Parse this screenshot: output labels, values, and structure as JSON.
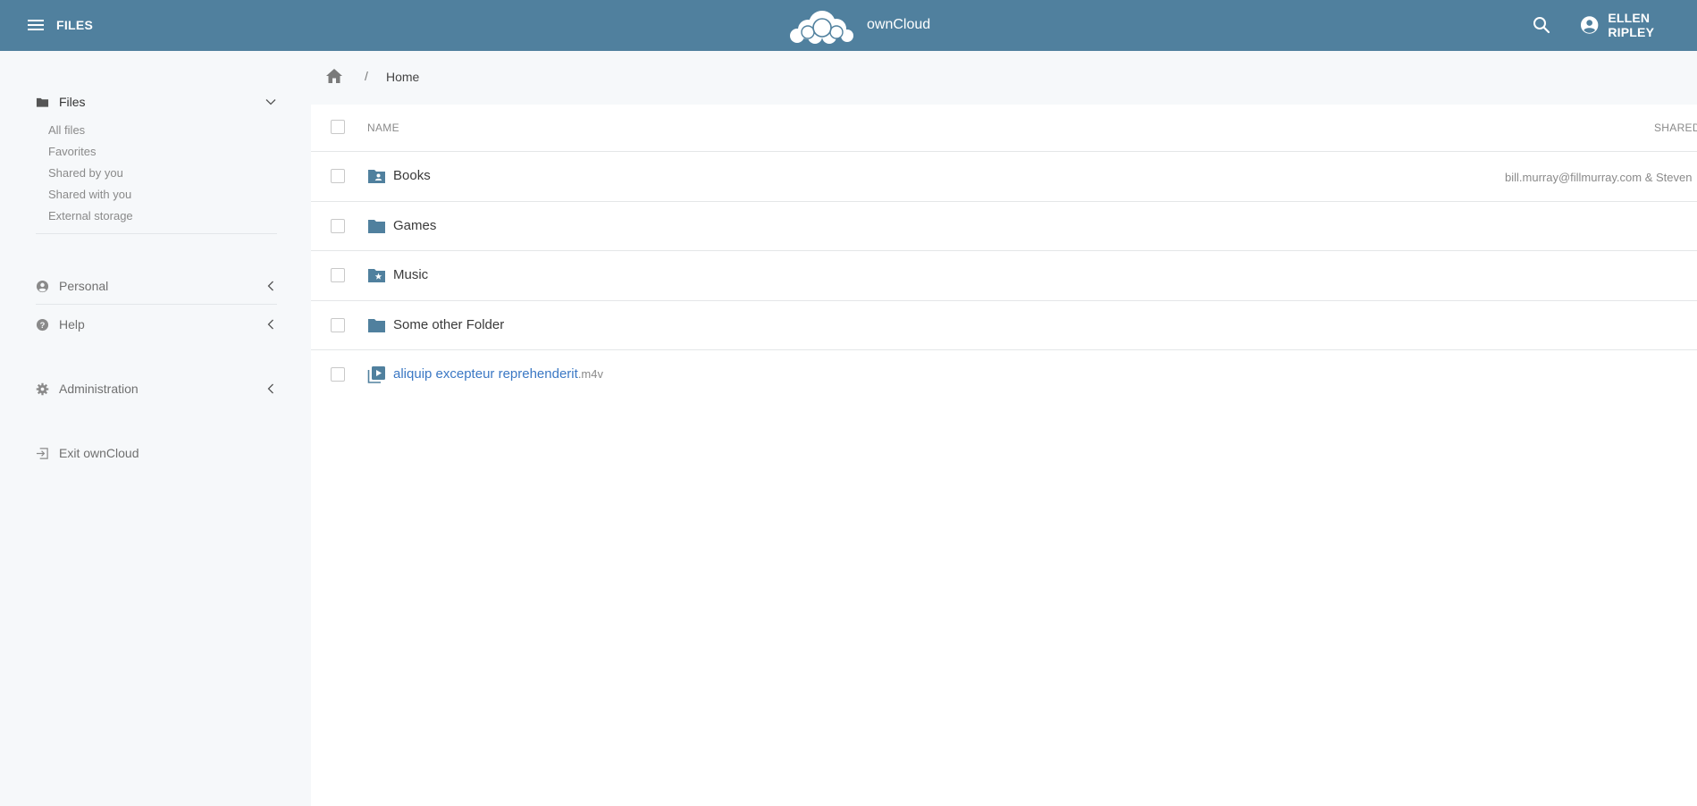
{
  "topbar": {
    "app_label": "FILES",
    "brand_name": "ownCloud",
    "user_name": "ELLEN RIPLEY",
    "background_color": "#50809e"
  },
  "sidebar": {
    "files": {
      "label": "Files",
      "items": [
        {
          "label": "All files"
        },
        {
          "label": "Favorites"
        },
        {
          "label": "Shared by you"
        },
        {
          "label": "Shared with you"
        },
        {
          "label": "External storage"
        }
      ]
    },
    "personal": {
      "label": "Personal"
    },
    "help": {
      "label": "Help"
    },
    "administration": {
      "label": "Administration"
    },
    "exit": {
      "label": "Exit ownCloud"
    }
  },
  "breadcrumb": {
    "separator": "/",
    "current": "Home"
  },
  "list": {
    "columns": {
      "name": "NAME",
      "shared": "SHARED"
    },
    "rows": [
      {
        "name": "Books",
        "ext": "",
        "icon": "shared-folder-icon",
        "shared_with": "bill.murray@fillmurray.com & Steven"
      },
      {
        "name": "Games",
        "ext": "",
        "icon": "folder-icon",
        "shared_with": ""
      },
      {
        "name": "Music",
        "ext": "",
        "icon": "starred-folder-icon",
        "shared_with": ""
      },
      {
        "name": "Some other Folder",
        "ext": "",
        "icon": "folder-icon",
        "shared_with": ""
      },
      {
        "name": "aliquip excepteur reprehenderit",
        "ext": ".m4v",
        "icon": "video-file-icon",
        "shared_with": ""
      }
    ]
  },
  "colors": {
    "accent": "#50809e",
    "link": "#3b78c4",
    "sidebar_bg": "#f6f8fa"
  }
}
